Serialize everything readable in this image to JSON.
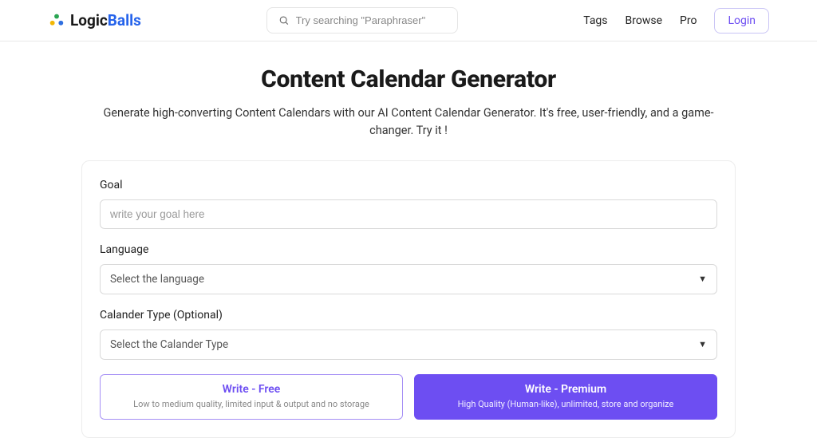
{
  "header": {
    "brand_first": "Logic",
    "brand_second": "Balls",
    "search_placeholder": "Try searching \"Paraphraser\"",
    "nav": {
      "tags": "Tags",
      "browse": "Browse",
      "pro": "Pro",
      "login": "Login"
    }
  },
  "page": {
    "title": "Content Calendar Generator",
    "subtitle": "Generate high-converting Content Calendars with our AI Content Calendar Generator. It's free, user-friendly, and a game-changer. Try it !"
  },
  "form": {
    "goal_label": "Goal",
    "goal_placeholder": "write your goal here",
    "language_label": "Language",
    "language_selected": "Select the language",
    "calendar_label": "Calander Type (Optional)",
    "calendar_selected": "Select the Calander Type",
    "free_btn_title": "Write - Free",
    "free_btn_sub": "Low to medium quality, limited input & output and no storage",
    "premium_btn_title": "Write - Premium",
    "premium_btn_sub": "High Quality (Human-like), unlimited, store and organize"
  }
}
